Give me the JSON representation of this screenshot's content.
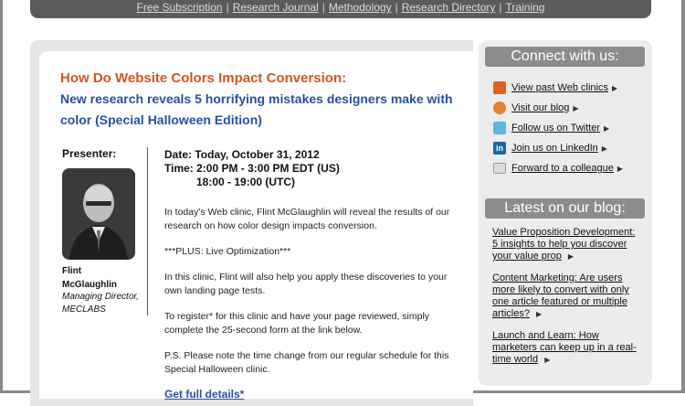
{
  "topnav": {
    "links": [
      "Free Subscription",
      "Research Journal",
      "Methodology",
      "Research Directory",
      "Training"
    ],
    "separator": "|"
  },
  "event": {
    "headline": "How Do Website Colors Impact Conversion:",
    "subhead": "New research reveals 5 horrifying mistakes designers make with color (Special Halloween Edition)",
    "presenter_label": "Presenter:",
    "presenter_first": "Flint",
    "presenter_last": "McGlaughlin",
    "presenter_role": "Managing Director, MECLABS",
    "date_line": "Date: Today, October 31, 2012",
    "time_line": "Time: 2:00 PM - 3:00 PM EDT (US)",
    "utc_line": "18:00 - 19:00 (UTC)",
    "paragraphs": [
      "In today's Web clinic, Flint McGlaughlin will reveal the results of our research on how color design impacts conversion.",
      "***PLUS: Live Optimization***",
      "In this clinic, Flint will also help you apply these discoveries to your own landing page tests.",
      "To register* for this clinic and have your page reviewed, simply complete the 25-second form at the link below.",
      "P.S. Please note the time change from our regular schedule for this Special Halloween clinic."
    ],
    "cta": "Get full details*"
  },
  "sidebar": {
    "connect_title": "Connect with us:",
    "connect_items": [
      {
        "label": "View past Web clinics",
        "icon": "web-clinic-icon"
      },
      {
        "label": "Visit our blog",
        "icon": "blog-icon"
      },
      {
        "label": "Follow us on Twitter",
        "icon": "twitter-icon"
      },
      {
        "label": "Join us on LinkedIn",
        "icon": "linkedin-icon"
      },
      {
        "label": "Forward to a colleague",
        "icon": "mail-icon"
      }
    ],
    "blog_title": "Latest on our blog:",
    "blog_items": [
      {
        "label": "Value Proposition Development: 5 insights to help you discover your value prop"
      },
      {
        "label": "Content Marketing: Are users more likely to convert with only one article featured or multiple articles?"
      },
      {
        "label": "Launch and Learn: How marketers can keep up in a real-time world"
      }
    ]
  },
  "colors": {
    "headline": "#d4541c",
    "subhead": "#27519b",
    "nav_bar": "#5b5b5b",
    "sidebar_header": "#8c8c8c"
  }
}
